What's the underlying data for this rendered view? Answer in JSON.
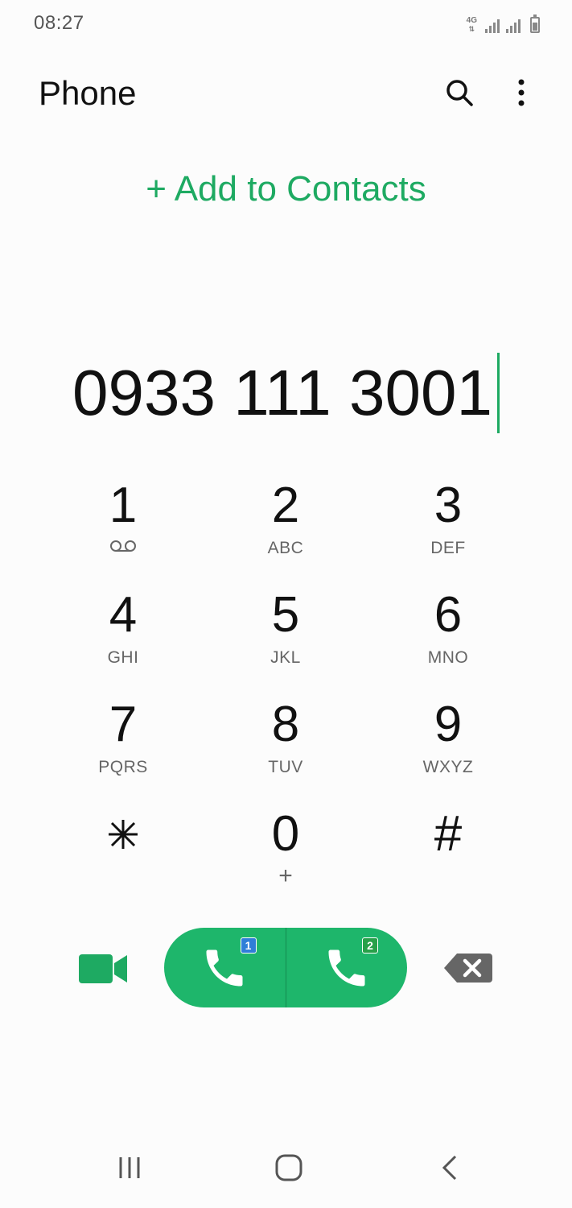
{
  "status_bar": {
    "time": "08:27",
    "network": "4G"
  },
  "header": {
    "title": "Phone",
    "search_icon": "search-icon",
    "more_icon": "more-vertical-icon"
  },
  "add_to_contacts": "+ Add to Contacts",
  "dialed_number": "0933 111 3001",
  "keypad": [
    {
      "digit": "1",
      "sub": ""
    },
    {
      "digit": "2",
      "sub": "ABC"
    },
    {
      "digit": "3",
      "sub": "DEF"
    },
    {
      "digit": "4",
      "sub": "GHI"
    },
    {
      "digit": "5",
      "sub": "JKL"
    },
    {
      "digit": "6",
      "sub": "MNO"
    },
    {
      "digit": "7",
      "sub": "PQRS"
    },
    {
      "digit": "8",
      "sub": "TUV"
    },
    {
      "digit": "9",
      "sub": "WXYZ"
    },
    {
      "digit": "⁎",
      "sub": ""
    },
    {
      "digit": "0",
      "sub": "+"
    },
    {
      "digit": "#",
      "sub": ""
    }
  ],
  "actions": {
    "sim1_label": "1",
    "sim2_label": "2"
  },
  "colors": {
    "accent": "#1eaa62",
    "call_button": "#1eb66b",
    "sim1": "#2f7ed8",
    "sim2": "#27a049"
  }
}
